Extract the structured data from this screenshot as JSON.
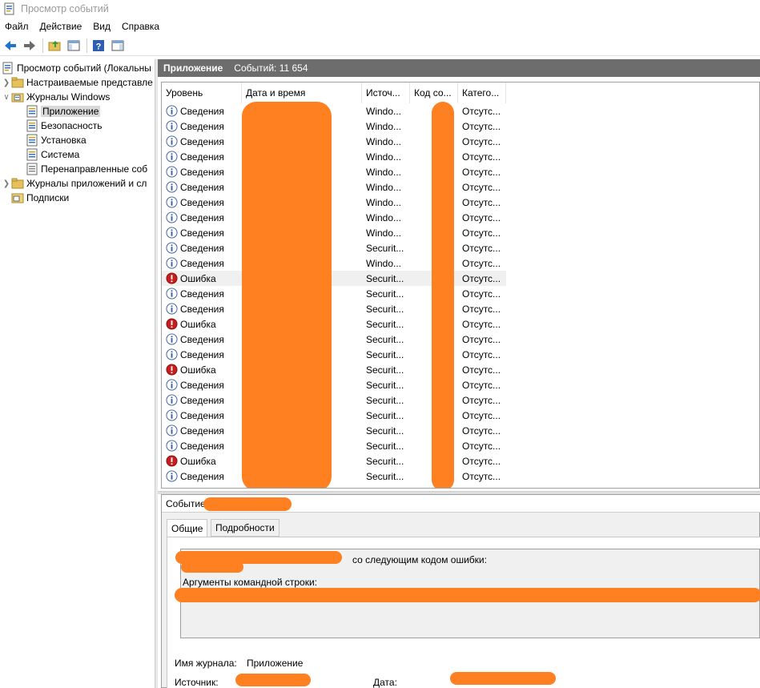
{
  "window": {
    "title": "Просмотр событий"
  },
  "menu": [
    "Файл",
    "Действие",
    "Вид",
    "Справка"
  ],
  "tree": {
    "root": "Просмотр событий (Локальны",
    "items": [
      {
        "label": "Настраиваемые представле",
        "level": 1
      },
      {
        "label": "Журналы Windows",
        "level": 1
      },
      {
        "label": "Приложение",
        "level": 2,
        "selected": true
      },
      {
        "label": "Безопасность",
        "level": 2
      },
      {
        "label": "Установка",
        "level": 2
      },
      {
        "label": "Система",
        "level": 2
      },
      {
        "label": "Перенаправленные соб",
        "level": 2
      },
      {
        "label": "Журналы приложений и сл",
        "level": 1
      },
      {
        "label": "Подписки",
        "level": 1
      }
    ]
  },
  "header": {
    "title": "Приложение",
    "count": "Событий: 11 654"
  },
  "columns": [
    "Уровень",
    "Дата и время",
    "Источ...",
    "Код со...",
    "Катего..."
  ],
  "events": [
    {
      "level": "Сведения",
      "type": "info",
      "source": "Windo...",
      "category": "Отсутс..."
    },
    {
      "level": "Сведения",
      "type": "info",
      "source": "Windo...",
      "category": "Отсутс..."
    },
    {
      "level": "Сведения",
      "type": "info",
      "source": "Windo...",
      "category": "Отсутс..."
    },
    {
      "level": "Сведения",
      "type": "info",
      "source": "Windo...",
      "category": "Отсутс..."
    },
    {
      "level": "Сведения",
      "type": "info",
      "source": "Windo...",
      "category": "Отсутс..."
    },
    {
      "level": "Сведения",
      "type": "info",
      "source": "Windo...",
      "category": "Отсутс..."
    },
    {
      "level": "Сведения",
      "type": "info",
      "source": "Windo...",
      "category": "Отсутс..."
    },
    {
      "level": "Сведения",
      "type": "info",
      "source": "Windo...",
      "category": "Отсутс..."
    },
    {
      "level": "Сведения",
      "type": "info",
      "source": "Windo...",
      "category": "Отсутс..."
    },
    {
      "level": "Сведения",
      "type": "info",
      "source": "Securit...",
      "category": "Отсутс..."
    },
    {
      "level": "Сведения",
      "type": "info",
      "source": "Windo...",
      "category": "Отсутс..."
    },
    {
      "level": "Ошибка",
      "type": "error",
      "source": "Securit...",
      "category": "Отсутс..."
    },
    {
      "level": "Сведения",
      "type": "info",
      "source": "Securit...",
      "category": "Отсутс..."
    },
    {
      "level": "Сведения",
      "type": "info",
      "source": "Securit...",
      "category": "Отсутс..."
    },
    {
      "level": "Ошибка",
      "type": "error",
      "source": "Securit...",
      "category": "Отсутс..."
    },
    {
      "level": "Сведения",
      "type": "info",
      "source": "Securit...",
      "category": "Отсутс..."
    },
    {
      "level": "Сведения",
      "type": "info",
      "source": "Securit...",
      "category": "Отсутс..."
    },
    {
      "level": "Ошибка",
      "type": "error",
      "source": "Securit...",
      "category": "Отсутс..."
    },
    {
      "level": "Сведения",
      "type": "info",
      "source": "Securit...",
      "category": "Отсутс..."
    },
    {
      "level": "Сведения",
      "type": "info",
      "source": "Securit...",
      "category": "Отсутс..."
    },
    {
      "level": "Сведения",
      "type": "info",
      "source": "Securit...",
      "category": "Отсутс..."
    },
    {
      "level": "Сведения",
      "type": "info",
      "source": "Securit...",
      "category": "Отсутс..."
    },
    {
      "level": "Сведения",
      "type": "info",
      "source": "Securit...",
      "category": "Отсутс..."
    },
    {
      "level": "Ошибка",
      "type": "error",
      "source": "Securit...",
      "category": "Отсутс..."
    },
    {
      "level": "Сведения",
      "type": "info",
      "source": "Securit...",
      "category": "Отсутс..."
    }
  ],
  "detail": {
    "title": "Событие",
    "tabs": [
      "Общие",
      "Подробности"
    ],
    "message_line1": "со следующим кодом ошибки:",
    "message_line2": "Аргументы командной строки:",
    "journal_label": "Имя журнала:",
    "journal_value": "Приложение",
    "source_label": "Источник:",
    "date_label": "Дата:"
  },
  "colors": {
    "header_band": "#6d6d6d",
    "redaction": "#fe8020",
    "selected": "#d9d9d9"
  }
}
